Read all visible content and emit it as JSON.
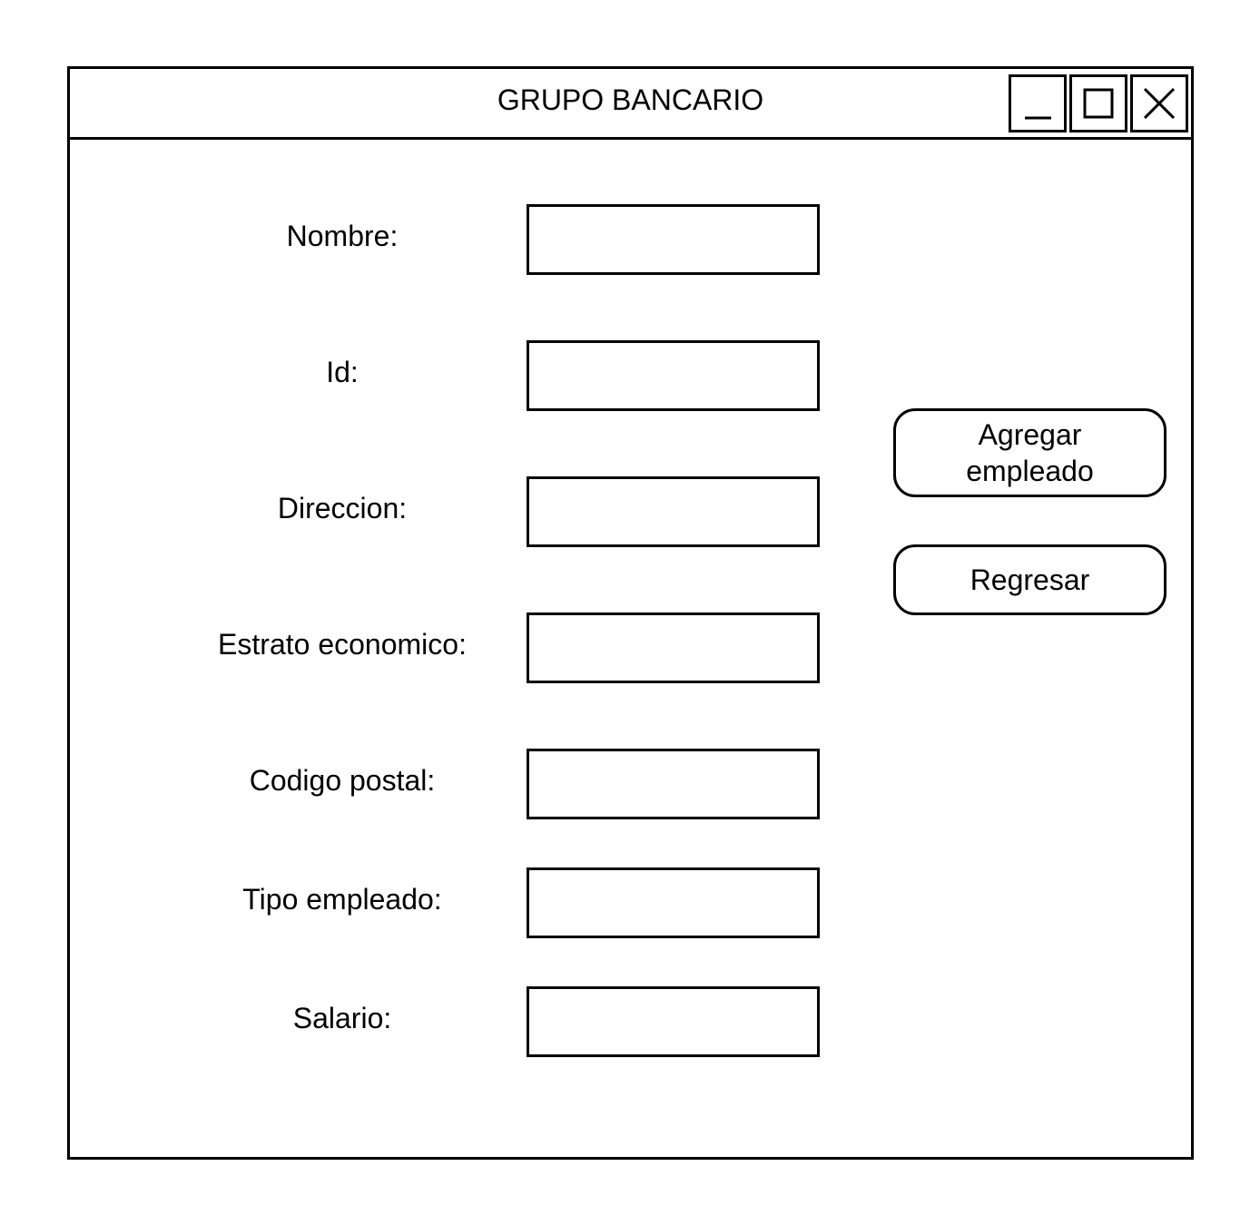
{
  "window": {
    "title": "GRUPO BANCARIO",
    "controls": [
      "minimize-icon",
      "maximize-icon",
      "close-icon"
    ]
  },
  "form": {
    "fields": [
      {
        "label": "Nombre:",
        "value": ""
      },
      {
        "label": "Id:",
        "value": ""
      },
      {
        "label": "Direccion:",
        "value": ""
      },
      {
        "label": "Estrato economico:",
        "value": ""
      },
      {
        "label": "Codigo postal:",
        "value": ""
      },
      {
        "label": "Tipo empleado:",
        "value": ""
      },
      {
        "label": "Salario:",
        "value": ""
      }
    ]
  },
  "actions": {
    "add_label": "Agregar\nempleado",
    "back_label": "Regresar"
  }
}
